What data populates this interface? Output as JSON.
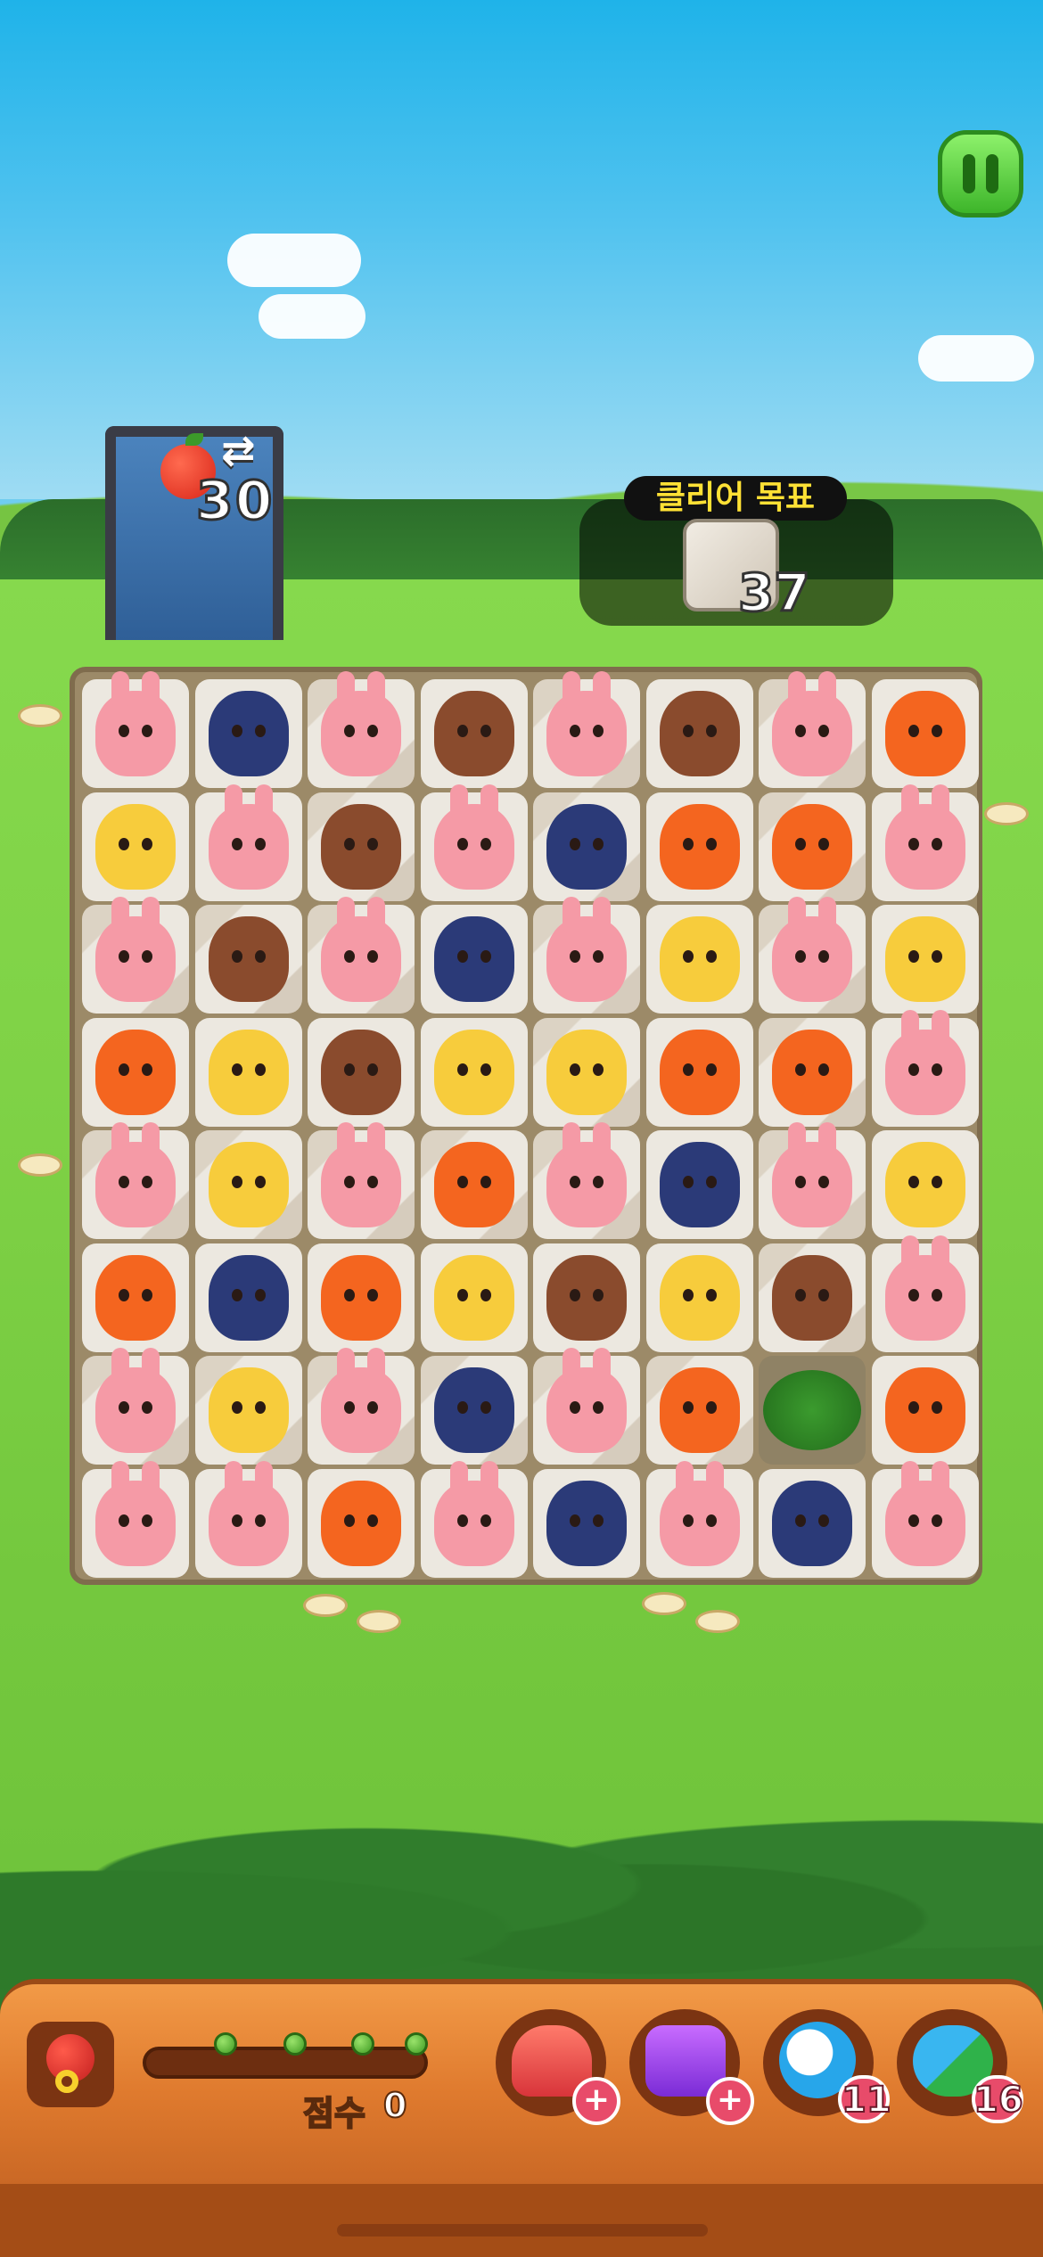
{
  "hud": {
    "moves_remaining": "30",
    "goal_title": "클리어 목표",
    "goal_count": "37",
    "goal_icon": "stone-tile-icon",
    "pause_icon": "pause-icon"
  },
  "board": {
    "columns": 8,
    "rows": 8,
    "cells": [
      [
        "bunny",
        "wolf",
        "bunny-cracked",
        "bear",
        "bunny-cracked",
        "bear",
        "bunny-cracked",
        "chick"
      ],
      [
        "giraffe",
        "bunny",
        "bear-cracked",
        "bunny",
        "wolf-cracked",
        "chick",
        "chick-cracked",
        "bunny"
      ],
      [
        "bunny-cracked",
        "bear-cracked",
        "bunny-cracked",
        "wolf",
        "bunny-cracked",
        "giraffe",
        "bunny-cracked",
        "giraffe"
      ],
      [
        "chick",
        "giraffe",
        "bear",
        "giraffe",
        "giraffe-cracked",
        "chick",
        "chick-cracked",
        "bunny"
      ],
      [
        "bunny-cracked",
        "giraffe-cracked",
        "bunny-cracked",
        "chick-cracked",
        "bunny-cracked",
        "wolf",
        "bunny-cracked",
        "giraffe"
      ],
      [
        "chick",
        "wolf",
        "chick",
        "giraffe",
        "bear",
        "giraffe",
        "bear-cracked",
        "bunny"
      ],
      [
        "bunny-cracked",
        "giraffe-cracked",
        "bunny-cracked",
        "wolf-cracked",
        "bunny-cracked",
        "chick-cracked",
        "bush",
        "chick"
      ],
      [
        "bunny",
        "bunny",
        "chick",
        "bunny",
        "wolf",
        "bunny",
        "wolf",
        "bunny"
      ]
    ]
  },
  "bottom_bar": {
    "score_label": "점수",
    "score_value": "0",
    "items": [
      {
        "name": "hammer",
        "icon": "hammer-icon",
        "badge": "+"
      },
      {
        "name": "magic-hammer",
        "icon": "star-hammer-icon",
        "badge": "+"
      },
      {
        "name": "shuffle-ball",
        "icon": "ball-icon",
        "badge": "11"
      },
      {
        "name": "swap",
        "icon": "swap-arrow-icon",
        "badge": "16"
      }
    ]
  },
  "colors": {
    "bunny": "#f59aa6",
    "wolf": "#2b3a78",
    "bear": "#8a4b2d",
    "chick": "#f4651f",
    "giraffe": "#f7cc3c"
  }
}
